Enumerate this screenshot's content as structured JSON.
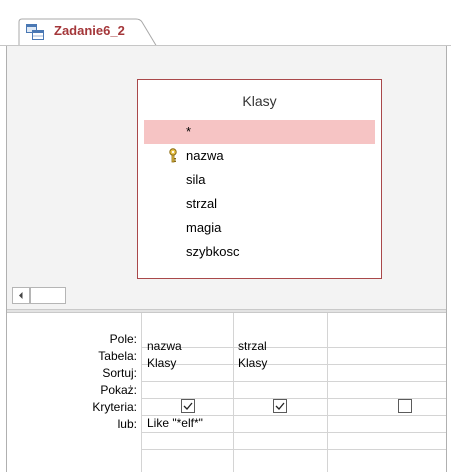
{
  "window": {
    "top_clipped_text": "",
    "tab_title": "Zadanie6_2"
  },
  "table": {
    "title": "Klasy",
    "fields": [
      {
        "name": "*",
        "selected": true,
        "primary_key": false
      },
      {
        "name": "nazwa",
        "selected": false,
        "primary_key": true
      },
      {
        "name": "sila",
        "selected": false,
        "primary_key": false
      },
      {
        "name": "strzal",
        "selected": false,
        "primary_key": false
      },
      {
        "name": "magia",
        "selected": false,
        "primary_key": false
      },
      {
        "name": "szybkosc",
        "selected": false,
        "primary_key": false
      }
    ]
  },
  "grid": {
    "row_labels": {
      "field": "Pole:",
      "table": "Tabela:",
      "sort": "Sortuj:",
      "show": "Pokaż:",
      "criteria": "Kryteria:",
      "or": "lub:"
    },
    "columns": [
      {
        "field": "nazwa",
        "table": "Klasy",
        "sort": "",
        "show": true,
        "criteria": "Like \"*elf*\"",
        "or": ""
      },
      {
        "field": "strzal",
        "table": "Klasy",
        "sort": "",
        "show": true,
        "criteria": "",
        "or": ""
      },
      {
        "field": "",
        "table": "",
        "sort": "",
        "show": false,
        "criteria": "",
        "or": ""
      }
    ]
  },
  "colors": {
    "accent": "#a4373a",
    "selected_row": "#f6c4c4",
    "table_border": "#a9484a"
  },
  "icons": {
    "tab": "query-design-icon",
    "key": "primary-key-icon"
  }
}
